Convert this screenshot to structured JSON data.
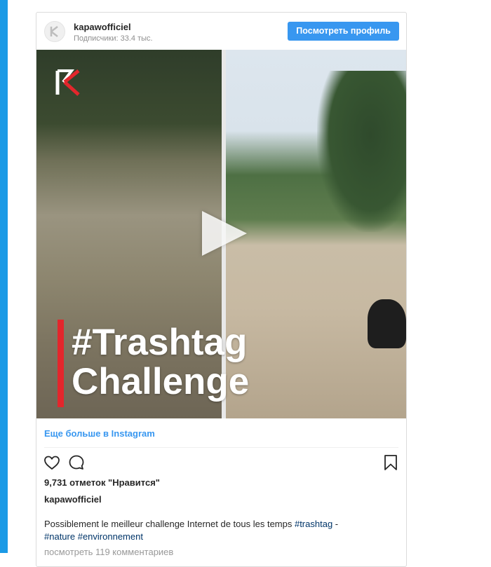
{
  "header": {
    "username": "kapawofficiel",
    "followers": "Подписчики: 33.4 тыс.",
    "view_profile_label": "Посмотреть профиль"
  },
  "media": {
    "title_line1": "#Trashtag",
    "title_line2": "Challenge"
  },
  "more_link": "Еще больше в Instagram",
  "likes": "9,731 отметок \"Нравится\"",
  "author": "kapawofficiel",
  "caption": {
    "text": "Possiblement le meilleur challenge Internet de tous les temps ",
    "tag1": "#trashtag",
    "sep": " -",
    "tag2": "#nature",
    "tag3": "#environnement"
  },
  "comments_link": "посмотреть 119 комментариев",
  "colors": {
    "accent": "#3897f0",
    "left_bar": "#1b9ae6",
    "hashtag": "#003569",
    "logo_red": "#e3262c"
  },
  "icons": [
    "heart-icon",
    "comment-icon",
    "bookmark-icon",
    "play-icon",
    "kapaw-logo"
  ]
}
